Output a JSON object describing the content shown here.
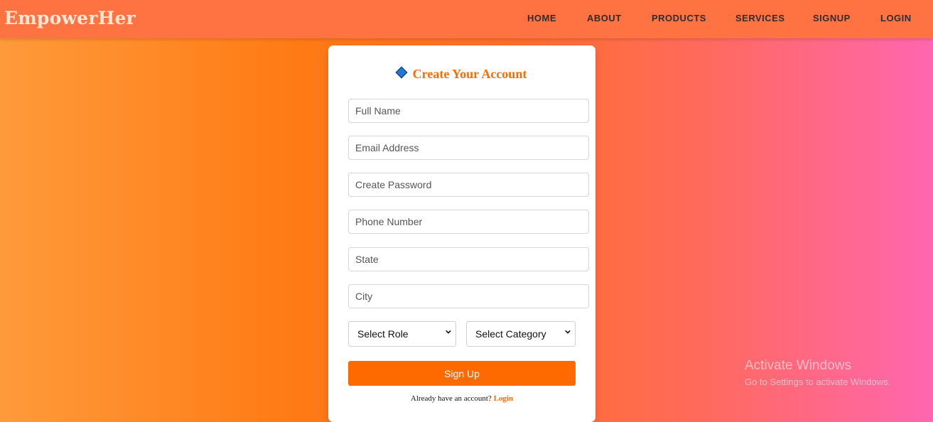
{
  "brand": "EmpowerHer",
  "nav": [
    "HOME",
    "ABOUT",
    "PRODUCTS",
    "SERVICES",
    "SIGNUP",
    "LOGIN"
  ],
  "form": {
    "title": "Create Your Account",
    "icon": "diamond-icon",
    "fields": {
      "full_name": "Full Name",
      "email": "Email Address",
      "password": "Create Password",
      "phone": "Phone Number",
      "state": "State",
      "city": "City"
    },
    "role_select": "Select Role",
    "category_select": "Select Category",
    "submit_label": "Sign Up",
    "footer_prompt": "Already have an account?",
    "footer_link": "Login"
  },
  "watermark": {
    "title": "Activate Windows",
    "subtitle": "Go to Settings to activate Windows."
  },
  "colors": {
    "accent": "#ff6a00",
    "navbar": "#ff7242",
    "gradient_start": "#ff9a3a",
    "gradient_end": "#ff66b0"
  }
}
